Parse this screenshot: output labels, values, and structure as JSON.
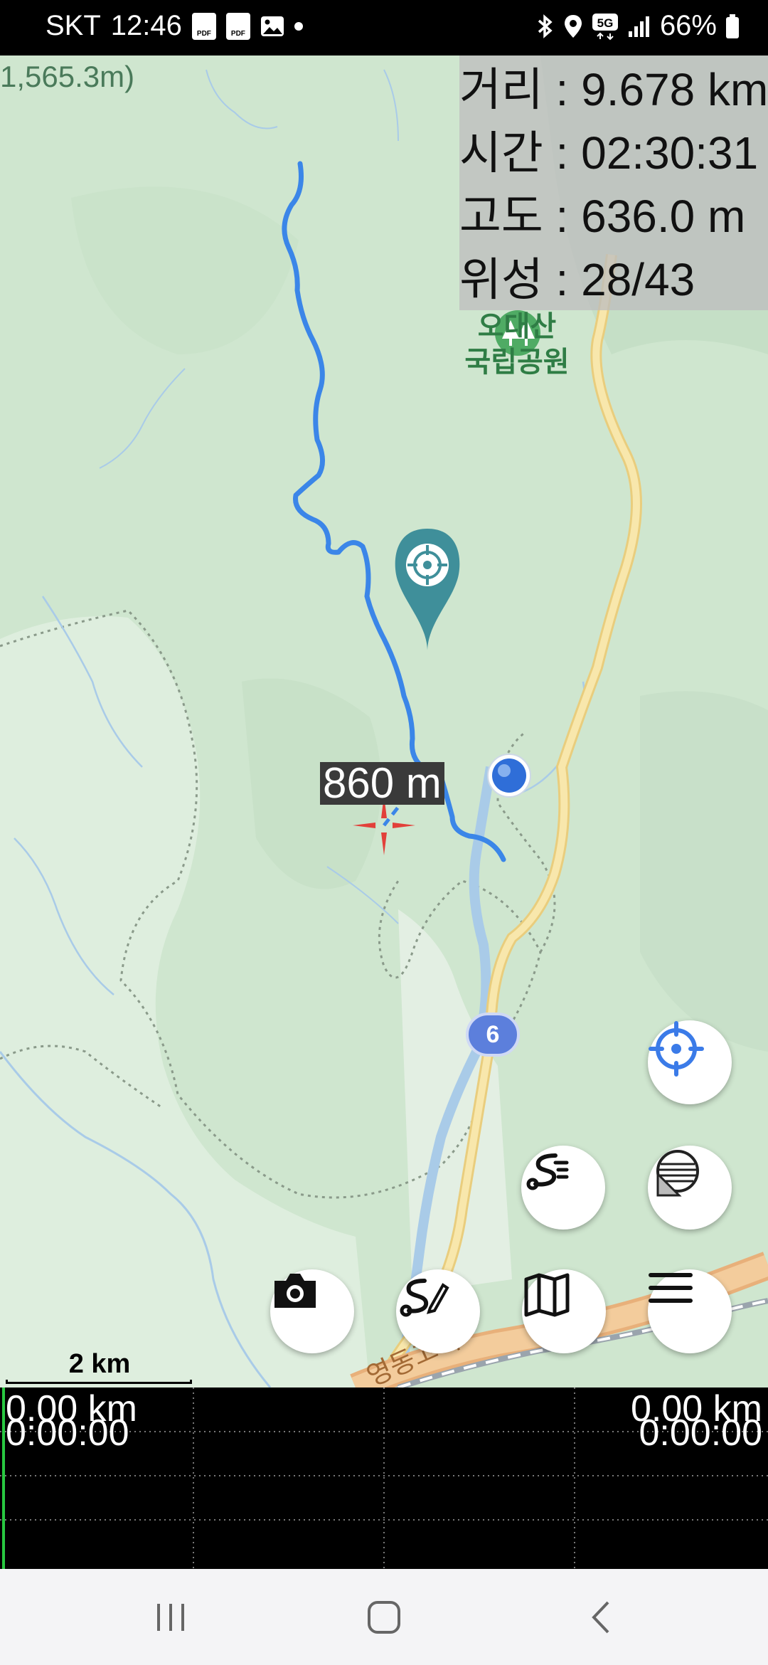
{
  "status_bar": {
    "carrier": "SKT",
    "time": "12:46",
    "pdf_label": "PDF",
    "network": "5G",
    "battery": "66%"
  },
  "map": {
    "peak_label": "1,565.3m)",
    "park_label_line1": "오대산",
    "park_label_line2": "국립공원",
    "route_number": "6",
    "distance_to_target": "860 m",
    "scale_label": "2 km"
  },
  "info_panel": {
    "distance": "거리 : 9.678 km",
    "time": "시간 : 02:30:31",
    "altitude": "고도 : 636.0 m",
    "satellites": "위성 : 28/43"
  },
  "graph": {
    "left_distance": "0.00 km",
    "left_time": "0:00:00",
    "right_distance": "0.00 km",
    "right_time": "0:00:00"
  },
  "icons": {
    "locate": "crosshair-icon",
    "track_list": "track-list-icon",
    "layers": "layers-icon",
    "camera": "camera-icon",
    "draw_route": "draw-route-icon",
    "map": "map-icon",
    "menu": "menu-icon"
  },
  "colors": {
    "track": "#3b86e8",
    "target_pin": "#3f8f9a",
    "map_green": "#cfe6cf",
    "road_yellow": "#f7e3a1",
    "accent_blue": "#3b7be8"
  }
}
